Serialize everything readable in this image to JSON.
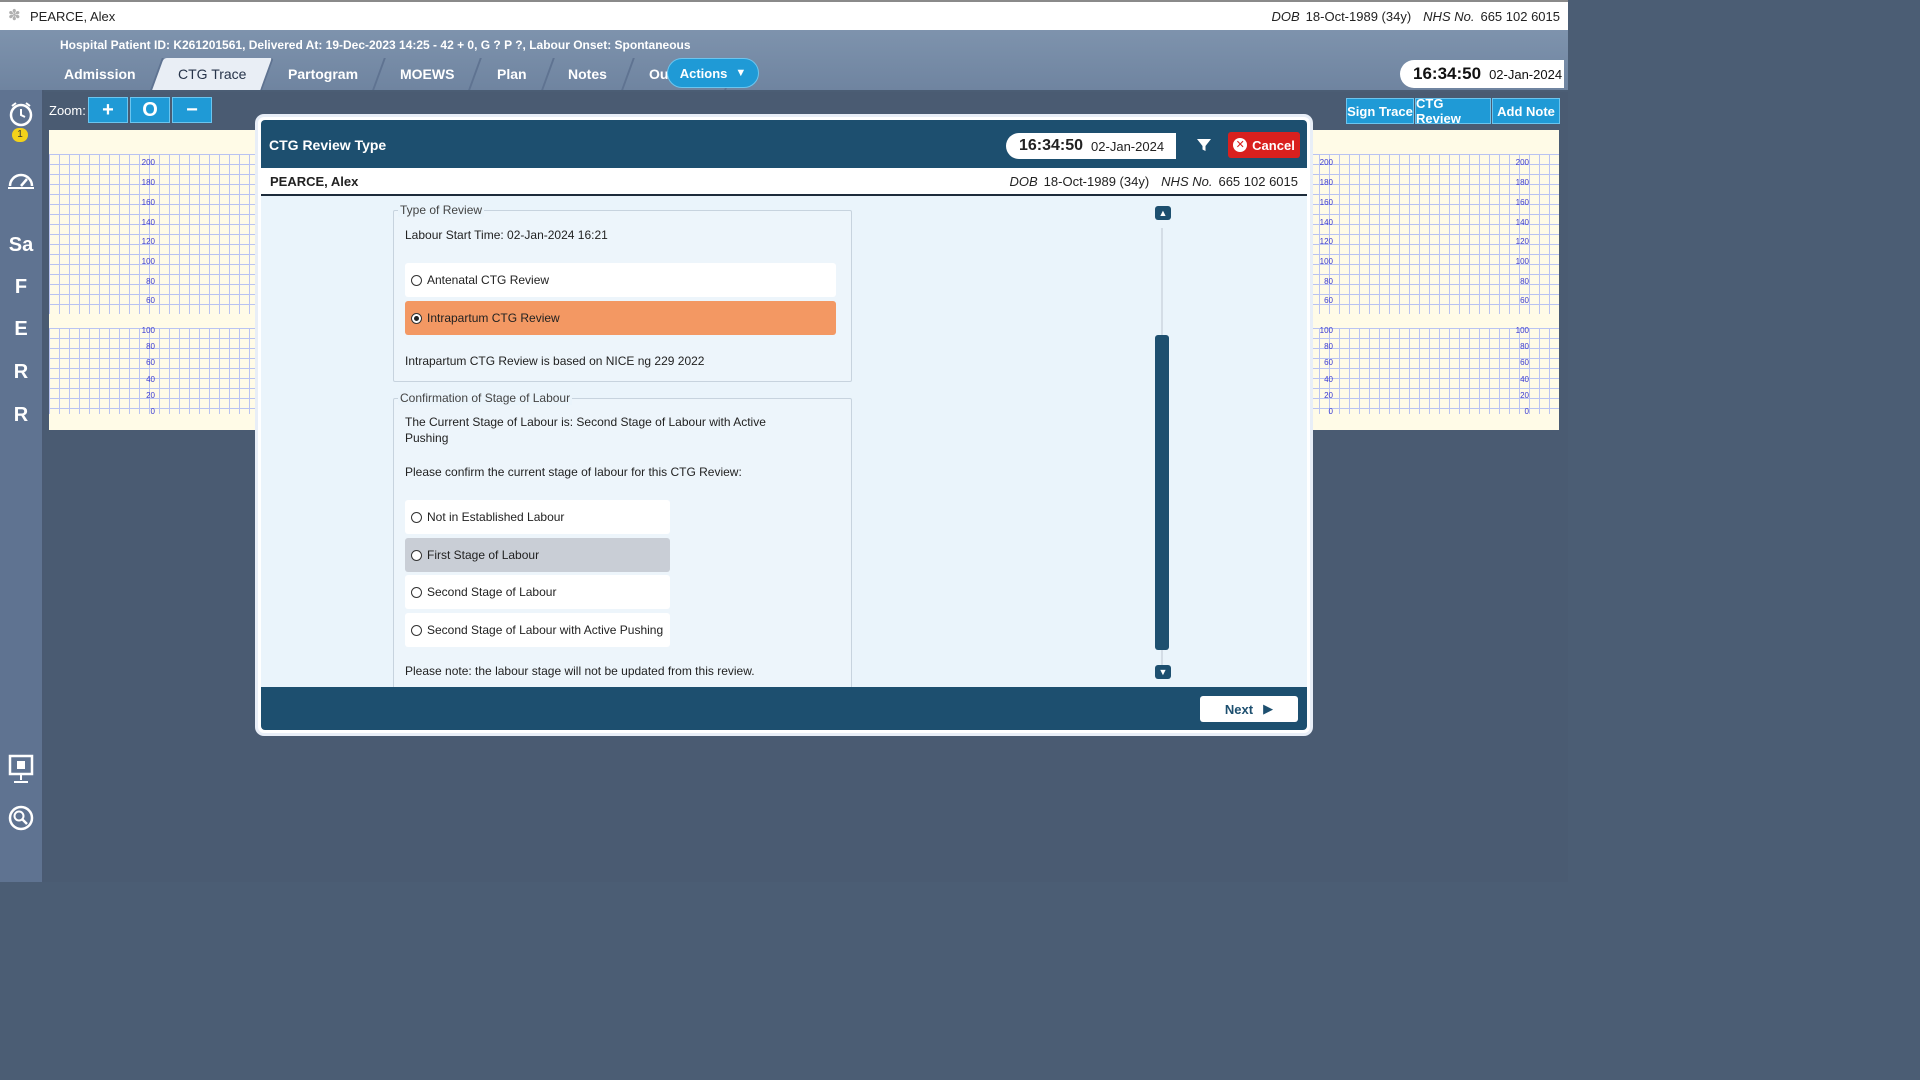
{
  "patient": {
    "name": "PEARCE, Alex",
    "dob_label": "DOB",
    "dob": "18-Oct-1989 (34y)",
    "nhs_label": "NHS No.",
    "nhs": "665 102 6015"
  },
  "header": {
    "info": "Hospital Patient ID: K261201561, Delivered At: 19-Dec-2023 14:25 - 42 + 0, G ? P ?,   Labour Onset: Spontaneous",
    "tabs": [
      "Admission",
      "CTG Trace",
      "Partogram",
      "MOEWS",
      "Plan",
      "Notes",
      "Outcome"
    ],
    "active_tab": "CTG Trace",
    "actions_label": "Actions",
    "time": "16:34:50",
    "date": "02-Jan-2024"
  },
  "sidebar": {
    "badge": "1",
    "letters": [
      "Sa",
      "F",
      "E",
      "R",
      "R"
    ],
    "icons": [
      "alarm-clock-icon",
      "gauge-icon",
      "presentation-icon",
      "search-icon"
    ]
  },
  "toolbar": {
    "zoom_label": "Zoom:",
    "zoom_in": "+",
    "zoom_reset": "O",
    "zoom_out": "−",
    "sign_trace": "Sign Trace",
    "ctg_review": "CTG Review",
    "add_note": "Add Note"
  },
  "ctg_axes": {
    "fhr": [
      "200",
      "180",
      "160",
      "140",
      "120",
      "100",
      "80",
      "60"
    ],
    "toco": [
      "100",
      "80",
      "60",
      "40",
      "20",
      "0"
    ]
  },
  "modal": {
    "title": "CTG Review Type",
    "time": "16:34:50",
    "date": "02-Jan-2024",
    "cancel": "Cancel",
    "type_of_review": {
      "legend": "Type of Review",
      "labour_start": "Labour Start Time: 02-Jan-2024 16:21",
      "options": [
        "Antenatal CTG Review",
        "Intrapartum CTG Review"
      ],
      "selected": "Intrapartum CTG Review",
      "note": "Intrapartum CTG Review is based on NICE ng 229 2022"
    },
    "stage": {
      "legend": "Confirmation of Stage of Labour",
      "current_line1": "The Current Stage of Labour is: Second Stage of Labour with Active",
      "current_line2": "Pushing",
      "prompt": "Please confirm the current stage of labour for this CTG Review:",
      "options": [
        "Not in Established Labour",
        "First Stage of Labour",
        "Second Stage of Labour",
        "Second Stage of Labour with Active Pushing"
      ],
      "note": "Please note: the labour stage will not be updated from this review."
    },
    "next": "Next"
  },
  "colors": {
    "accent": "#1f9ad6",
    "modal_header": "#1d4f6f",
    "selected_option": "#f39863",
    "cancel": "#d9201e"
  }
}
